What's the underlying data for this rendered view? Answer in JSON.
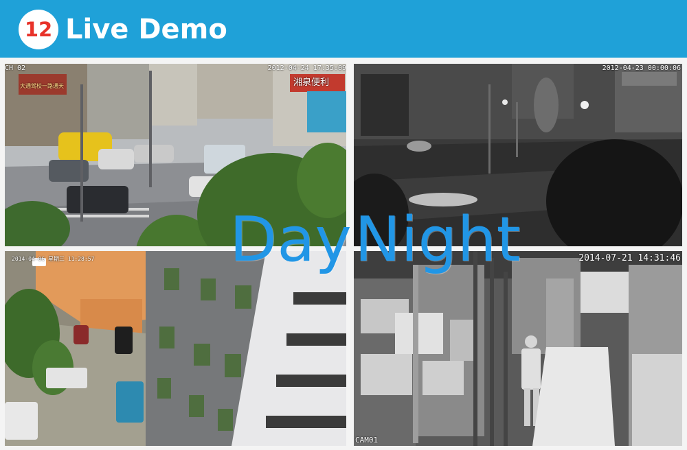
{
  "header": {
    "badge_number": "12",
    "title": "Live Demo",
    "background_color": "#1fa1d8",
    "badge_text_color": "#e8332a"
  },
  "overlay": {
    "day_label": "Day",
    "night_label": "Night",
    "color": "#2196e6"
  },
  "panels": {
    "top_left": {
      "channel": "CH 02",
      "timestamp": "2012-04-24 17:35:09",
      "scene": "day-street-intersection"
    },
    "top_right": {
      "timestamp": "2012-04-23 00:00:06",
      "scene": "night-street-intersection"
    },
    "bottom_left": {
      "timestamp": "2014-04-06 星期三 11:28:57",
      "scene": "day-building-aerial"
    },
    "bottom_right": {
      "timestamp": "2014-07-21 14:31:46",
      "channel": "CAM01",
      "scene": "night-warehouse-ir"
    }
  },
  "shop_signs": {
    "top_left_sign": "湘泉便利",
    "top_left_left_sign": "大通驾校一路通天"
  }
}
